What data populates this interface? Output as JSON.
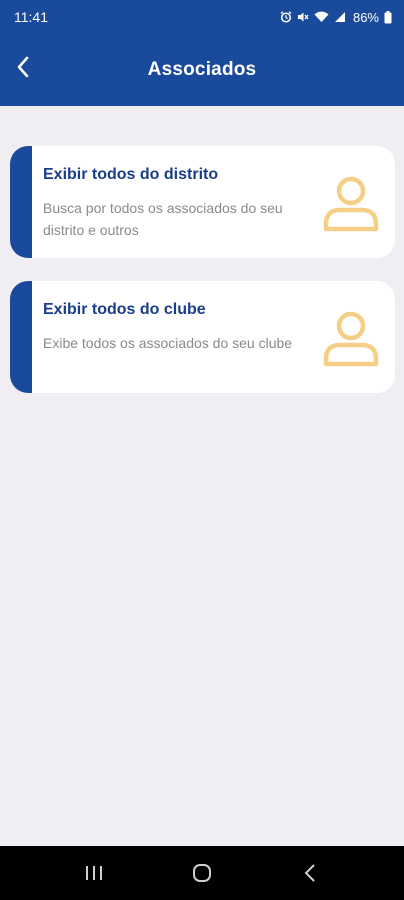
{
  "status_bar": {
    "time": "11:41",
    "battery": "86%"
  },
  "app_bar": {
    "title": "Associados",
    "back_icon": "chevron-left-icon"
  },
  "cards": [
    {
      "title": "Exibir todos do distrito",
      "description": "Busca por todos os associados do seu distrito e outros",
      "icon": "person-icon"
    },
    {
      "title": "Exibir todos do clube",
      "description": "Exibe todos os associados do seu clube",
      "icon": "person-icon"
    }
  ],
  "colors": {
    "primary": "#1a4a9c",
    "title_text": "#1a3d8a",
    "icon_accent": "#f5cf85",
    "background": "#f0eef2"
  },
  "nav_bar": {
    "recent_icon": "recent-apps-icon",
    "home_icon": "home-icon",
    "back_icon": "back-icon"
  }
}
